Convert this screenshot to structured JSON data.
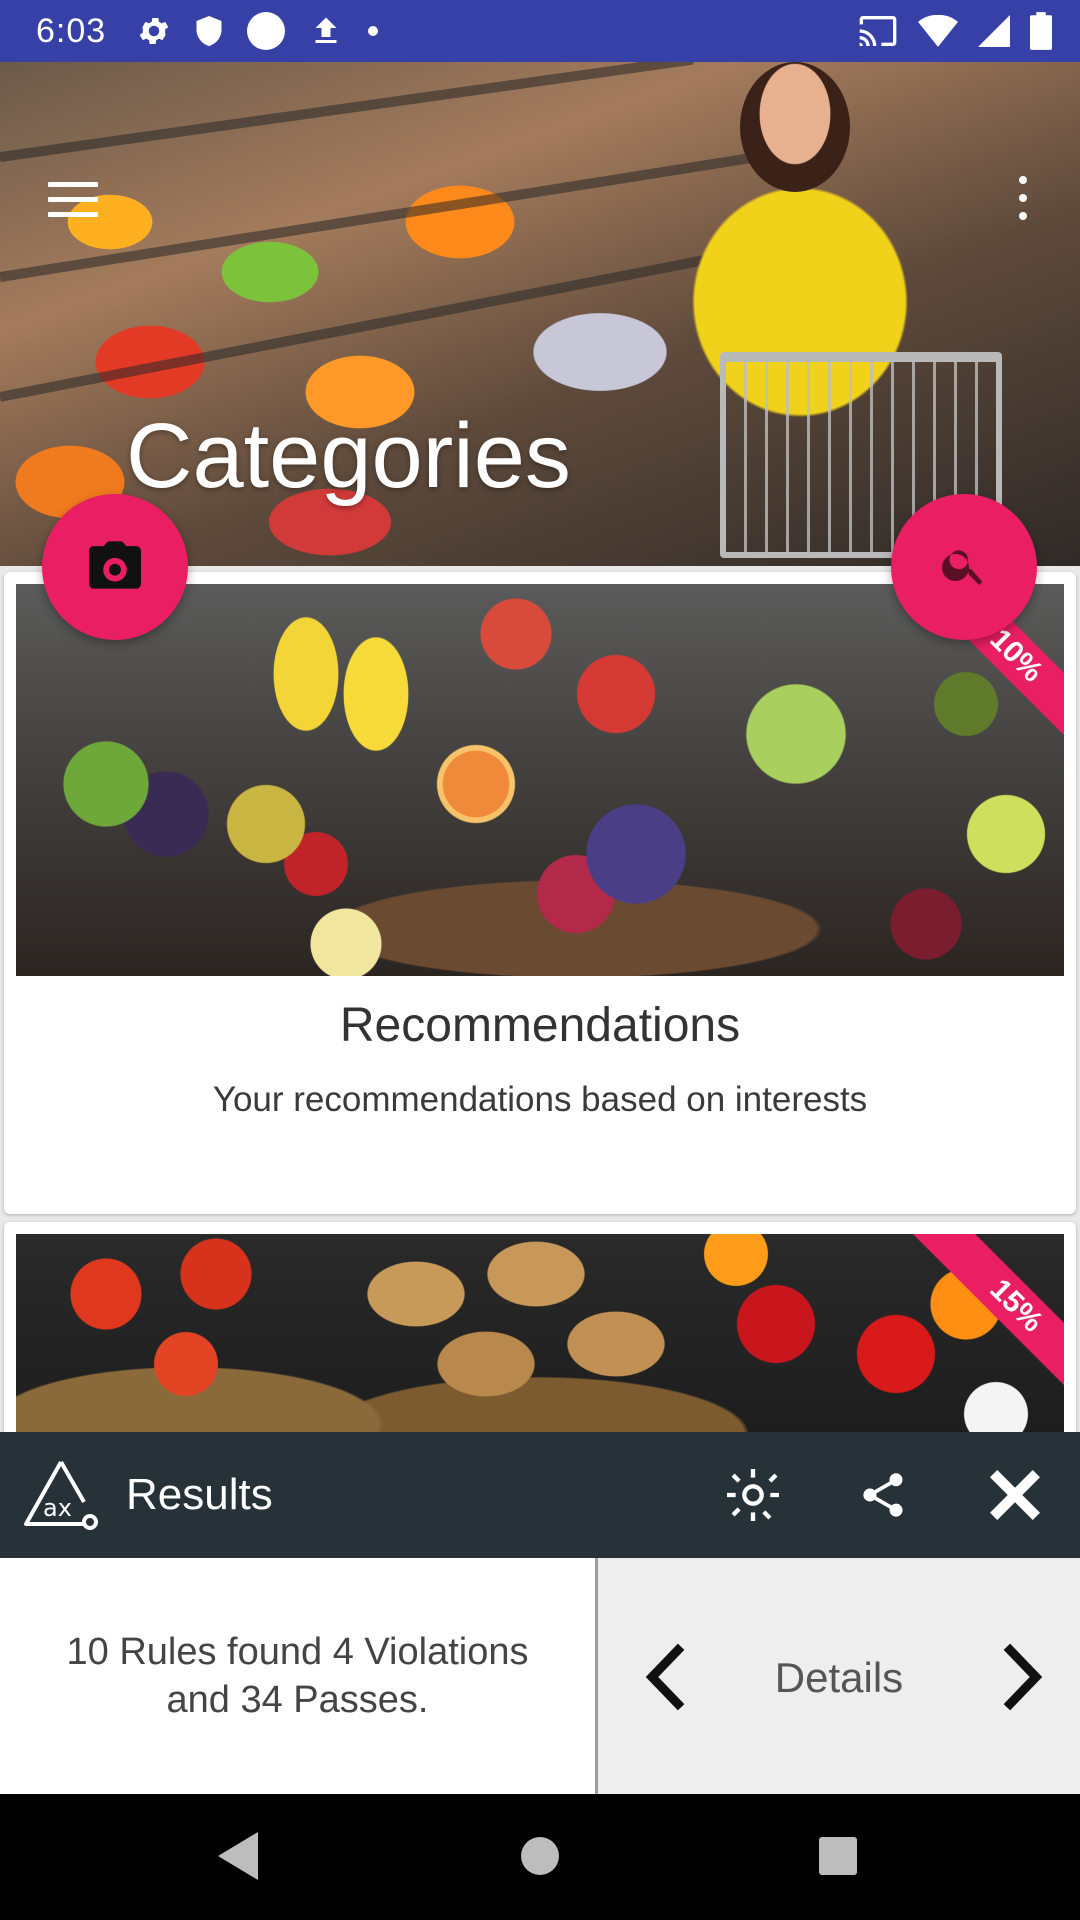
{
  "status_bar": {
    "time": "6:03",
    "left_icons": [
      "settings-icon",
      "shield-icon",
      "circle-icon",
      "upload-icon",
      "dot-icon"
    ],
    "right_icons": [
      "cast-icon",
      "wifi-icon",
      "signal-icon",
      "battery-icon"
    ]
  },
  "hero": {
    "title": "Categories"
  },
  "fabs": {
    "camera_icon": "camera-icon",
    "search_icon": "search-icon"
  },
  "cards": [
    {
      "badge": "10%",
      "title": "Recommendations",
      "subtitle": "Your recommendations based on interests"
    },
    {
      "badge": "15%"
    }
  ],
  "results": {
    "title": "Results",
    "summary": "10 Rules found 4 Violations and 34 Passes.",
    "details_label": "Details"
  },
  "colors": {
    "status_bar": "#3740a6",
    "accent": "#e91e63",
    "results_bar": "#263238"
  }
}
